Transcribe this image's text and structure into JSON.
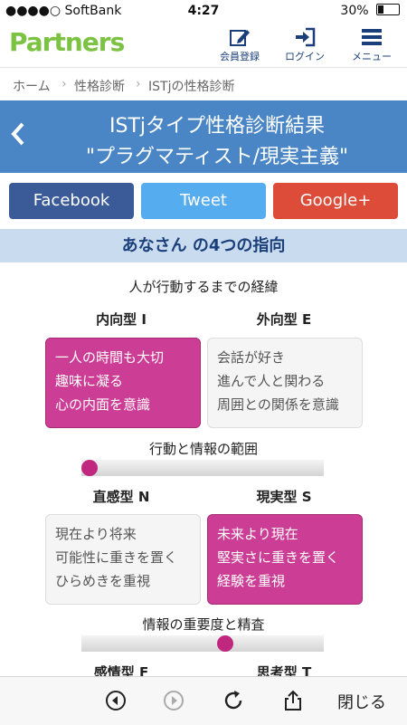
{
  "status": {
    "carrier": "●●●●○ SoftBank",
    "time": "4:27",
    "battery": "30%",
    "battery_level": 0.3
  },
  "header": {
    "logo": "Partners",
    "nav": [
      {
        "label": "会員登録",
        "icon": "edit-icon"
      },
      {
        "label": "ログイン",
        "icon": "login-icon"
      },
      {
        "label": "メニュー",
        "icon": "menu-icon"
      }
    ]
  },
  "breadcrumb": [
    "ホーム",
    "性格診断",
    "ISTjの性格診断"
  ],
  "banner": {
    "title_line1": "ISTjタイプ性格診断結果",
    "title_line2": "\"プラグマティスト/現実主義\""
  },
  "social": {
    "facebook": "Facebook",
    "tweet": "Tweet",
    "google": "Google+"
  },
  "section_title": "あなさん の4つの指向",
  "dimensions": [
    {
      "caption": "人が行動するまでの経緯",
      "left": {
        "label": "内向型 I",
        "lines": [
          "一人の時間も大切",
          "趣味に凝る",
          "心の内面を意識"
        ],
        "active": true
      },
      "right": {
        "label": "外向型 E",
        "lines": [
          "会話が好き",
          "進んで人と関わる",
          "周囲との関係を意識"
        ],
        "active": false
      },
      "scale_caption": "行動と情報の範囲",
      "scale_level": 0.0
    },
    {
      "left": {
        "label": "直感型 N",
        "lines": [
          "現在より将来",
          "可能性に重きを置く",
          "ひらめきを重視"
        ],
        "active": false
      },
      "right": {
        "label": "現実型 S",
        "lines": [
          "未来より現在",
          "堅実さに重きを置く",
          "経験を重視"
        ],
        "active": true
      },
      "scale_caption": "情報の重要度と精査",
      "scale_level": 0.6
    },
    {
      "left": {
        "label": "感情型 F"
      },
      "right": {
        "label": "思考型 T"
      }
    }
  ],
  "bottom": {
    "close_label": "閉じる"
  },
  "colors": {
    "accent": "#cc3e95",
    "banner": "#4a86c5",
    "facebook": "#3b5a98",
    "tweet": "#55acee",
    "google": "#dd4b39",
    "logo": "#7cc243"
  }
}
